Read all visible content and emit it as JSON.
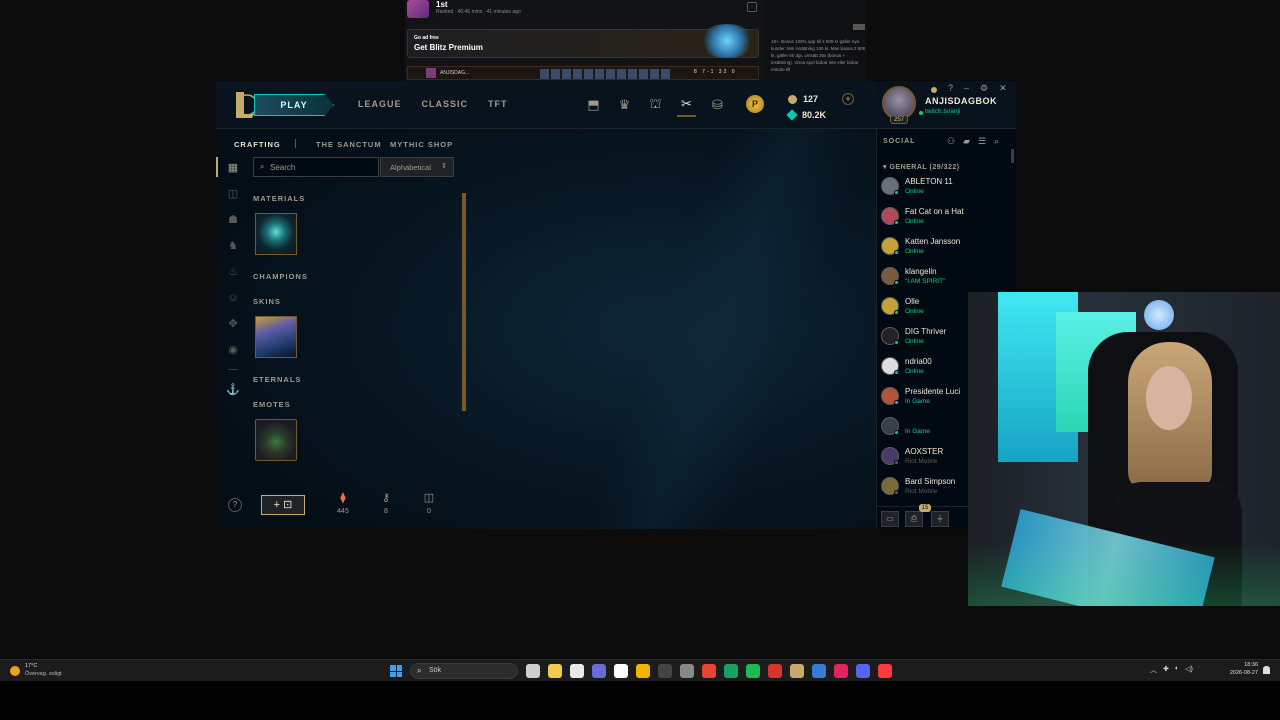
{
  "blitz": {
    "rank": "1st",
    "meta": "Ranked · 40:46 mins · 41 minutes ago",
    "promo_small": "Go ad free",
    "promo_big": "Get Blitz Premium",
    "last_game_name": "ANJISDAG...",
    "last_game_kda": "8  7-1  32  0"
  },
  "casino_text": "18+. Bonus 100% upp till 2 500 kr gäller nya kunder. Min insättning 100 kr. Max bonus 2 500 kr, gäller 60 dgr, omsätt 35x (bonus + insättning). Vissa spel bidrar inte eller bidrar mindre till",
  "client": {
    "play_label": "PLAY",
    "nav": [
      "LEAGUE",
      "CLASSIC",
      "TFT"
    ],
    "nav_icons": [
      "collection-icon",
      "ranked-icon",
      "store-icon",
      "loot-icon",
      "currency-icon"
    ],
    "rp_coin": "P",
    "be": "127",
    "rp": "80.2K",
    "currency_plus": "+",
    "profile": {
      "name": "ANJISDAGBOK",
      "status": "twitch.tv/anji",
      "level": "257"
    },
    "window_controls": [
      "?",
      "–",
      "⚙",
      "✕"
    ],
    "subnav": {
      "crafting": "CRAFTING",
      "sanctum": "THE SANCTUM",
      "mythic": "MYTHIC SHOP"
    },
    "search_placeholder": "Search",
    "sort": "Alphabetical",
    "sections": {
      "materials": "MATERIALS",
      "champions": "CHAMPIONS",
      "skins": "SKINS",
      "eternals": "ETERNALS",
      "emotes": "EMOTES"
    },
    "bottom": {
      "help": "?",
      "add": "+ ⊡",
      "orange_essence": "445",
      "keys": "8",
      "chests": "0"
    }
  },
  "social": {
    "title": "SOCIAL",
    "group": "GENERAL (29/322)",
    "friends": [
      {
        "name": "ABLETON 11",
        "status": "Online",
        "kind": "online"
      },
      {
        "name": "Fat Cat on a Hat",
        "status": "Online",
        "kind": "online"
      },
      {
        "name": "Katten Jansson",
        "status": "Online",
        "kind": "online"
      },
      {
        "name": "klangelin",
        "status": "\"I AM SPIRIT\"",
        "kind": "online"
      },
      {
        "name": "Olle",
        "status": "Online",
        "kind": "online"
      },
      {
        "name": "DIG Thriver",
        "status": "Online",
        "kind": "online"
      },
      {
        "name": "ndria00",
        "status": "Online",
        "kind": "online"
      },
      {
        "name": "Presidente Luci",
        "status": "In Game",
        "kind": "game"
      },
      {
        "name": "",
        "status": "In Game",
        "kind": "game"
      },
      {
        "name": "AOXSTER",
        "status": "Riot Mobile",
        "kind": "mobile"
      },
      {
        "name": "Bard Simpson",
        "status": "Riot Mobile",
        "kind": "mobile"
      }
    ],
    "footer_count": "15"
  },
  "taskbar": {
    "temp": "17°C",
    "weather": "Övervag. soligt",
    "search": "Sök",
    "time": "18:36",
    "date": "2026-08-27"
  },
  "colors": {
    "gold": "#c8aa6e",
    "teal": "#0ac8b9",
    "online": "#0acf83",
    "bg": "#010a13"
  }
}
